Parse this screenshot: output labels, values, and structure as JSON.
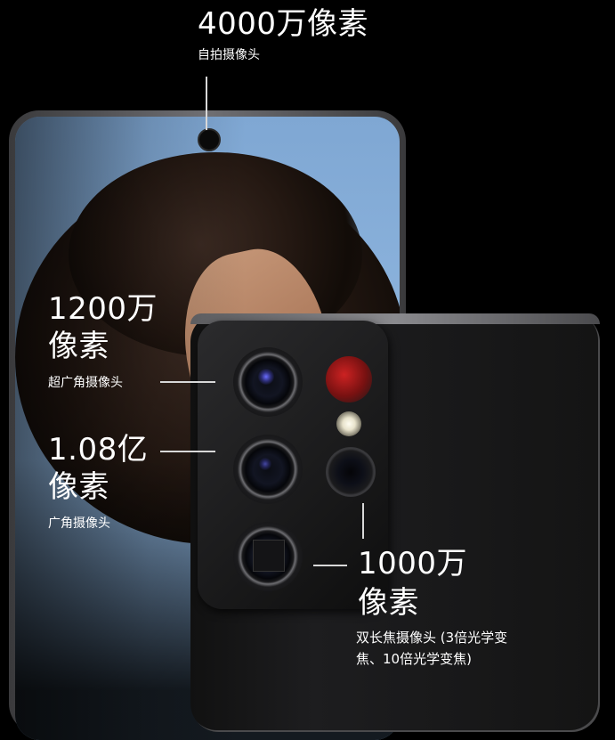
{
  "front_camera": {
    "value": "4000万像素",
    "desc": "自拍摄像头"
  },
  "ultrawide": {
    "value_line1": "1200万",
    "value_line2": "像素",
    "desc": "超广角摄像头"
  },
  "wide": {
    "value_line1": "1.08亿",
    "value_line2": "像素",
    "desc": "广角摄像头"
  },
  "telephoto": {
    "value_line1": "1000万",
    "value_line2": "像素",
    "desc_line1": "双长焦摄像头 (3倍光学变",
    "desc_line2": "焦、10倍光学变焦)"
  }
}
